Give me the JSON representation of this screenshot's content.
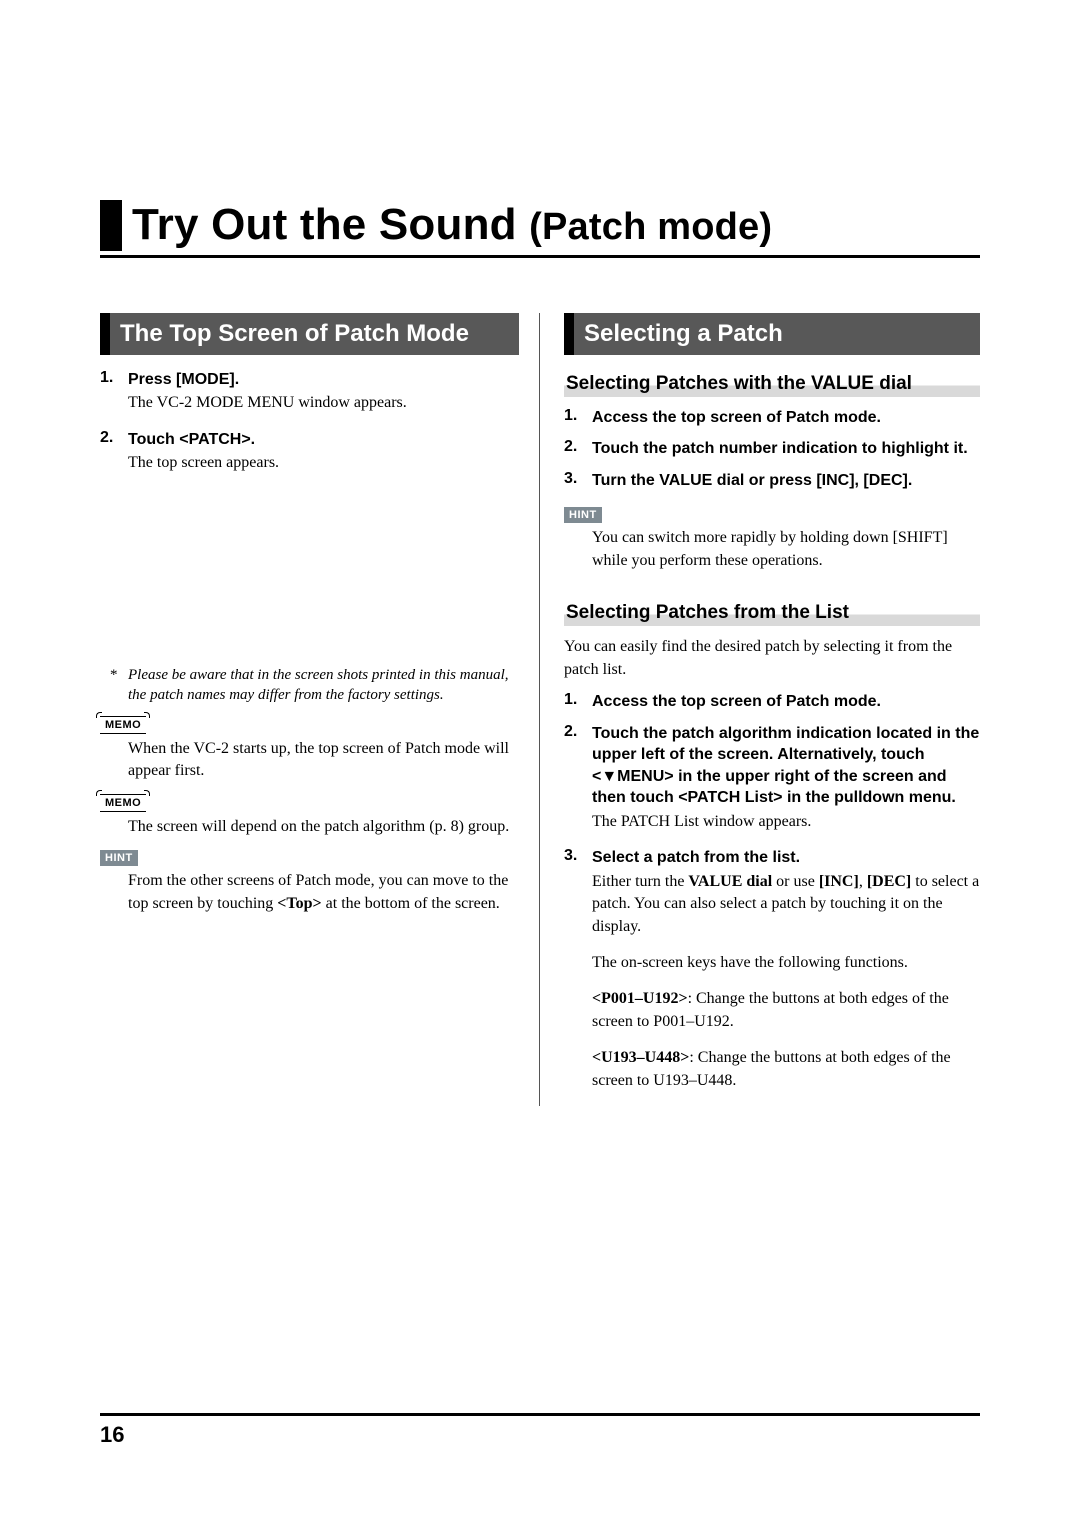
{
  "page_number": "16",
  "title_main": "Try Out the Sound ",
  "title_paren": "(Patch mode)",
  "left": {
    "section_title": "The Top Screen of Patch Mode",
    "steps": [
      {
        "head": "Press [MODE].",
        "body": "The VC-2 MODE MENU window appears."
      },
      {
        "head": "Touch <PATCH>.",
        "body": "The top screen appears."
      }
    ],
    "footnote": "Please be aware that in the screen shots printed in this manual, the patch names may differ from the factory settings.",
    "memo1_label": "MEMO",
    "memo1": "When the VC-2 starts up, the top screen of Patch mode will appear first.",
    "memo2_label": "MEMO",
    "memo2": "The screen will depend on the patch algorithm (p. 8) group.",
    "hint_label": "HINT",
    "hint_pre": "From the other screens of Patch mode, you can move to the top screen by touching ",
    "hint_bold": "<Top>",
    "hint_post": " at the bottom of the screen."
  },
  "right": {
    "section_title": "Selecting a Patch",
    "sub1_title": "Selecting Patches with the VALUE dial",
    "sub1_steps": [
      {
        "head": "Access the top screen of Patch mode."
      },
      {
        "head": "Touch the patch number indication to highlight it."
      },
      {
        "head": "Turn the VALUE dial or press [INC], [DEC]."
      }
    ],
    "sub1_hint_label": "HINT",
    "sub1_hint": "You can switch more rapidly by holding down [SHIFT] while you perform these operations.",
    "sub2_title": "Selecting Patches from the List",
    "sub2_intro": "You can easily find the desired patch by selecting it from the patch list.",
    "sub2_step1_head": "Access the top screen of Patch mode.",
    "sub2_step2_head": "Touch the patch algorithm indication located in the upper left of the screen. Alternatively, touch <▼MENU> in the upper right of the screen and then touch <PATCH List> in the pulldown menu.",
    "sub2_step2_body": "The PATCH List window appears.",
    "sub2_step3_head": "Select a patch from the list.",
    "sub2_step3_p1_a": "Either turn the ",
    "sub2_step3_p1_b": "VALUE dial",
    "sub2_step3_p1_c": " or use ",
    "sub2_step3_p1_d": "[INC]",
    "sub2_step3_p1_e": ", ",
    "sub2_step3_p1_f": "[DEC]",
    "sub2_step3_p1_g": " to select a patch. You can also select a patch by touching it on the display.",
    "sub2_step3_p2": "The on-screen keys have the following functions.",
    "sub2_step3_p3_a": "<P001–U192>",
    "sub2_step3_p3_b": ": Change the buttons at both edges of the screen to P001–U192.",
    "sub2_step3_p4_a": "<U193–U448>",
    "sub2_step3_p4_b": ": Change the buttons at both edges of the screen to U193–U448."
  }
}
